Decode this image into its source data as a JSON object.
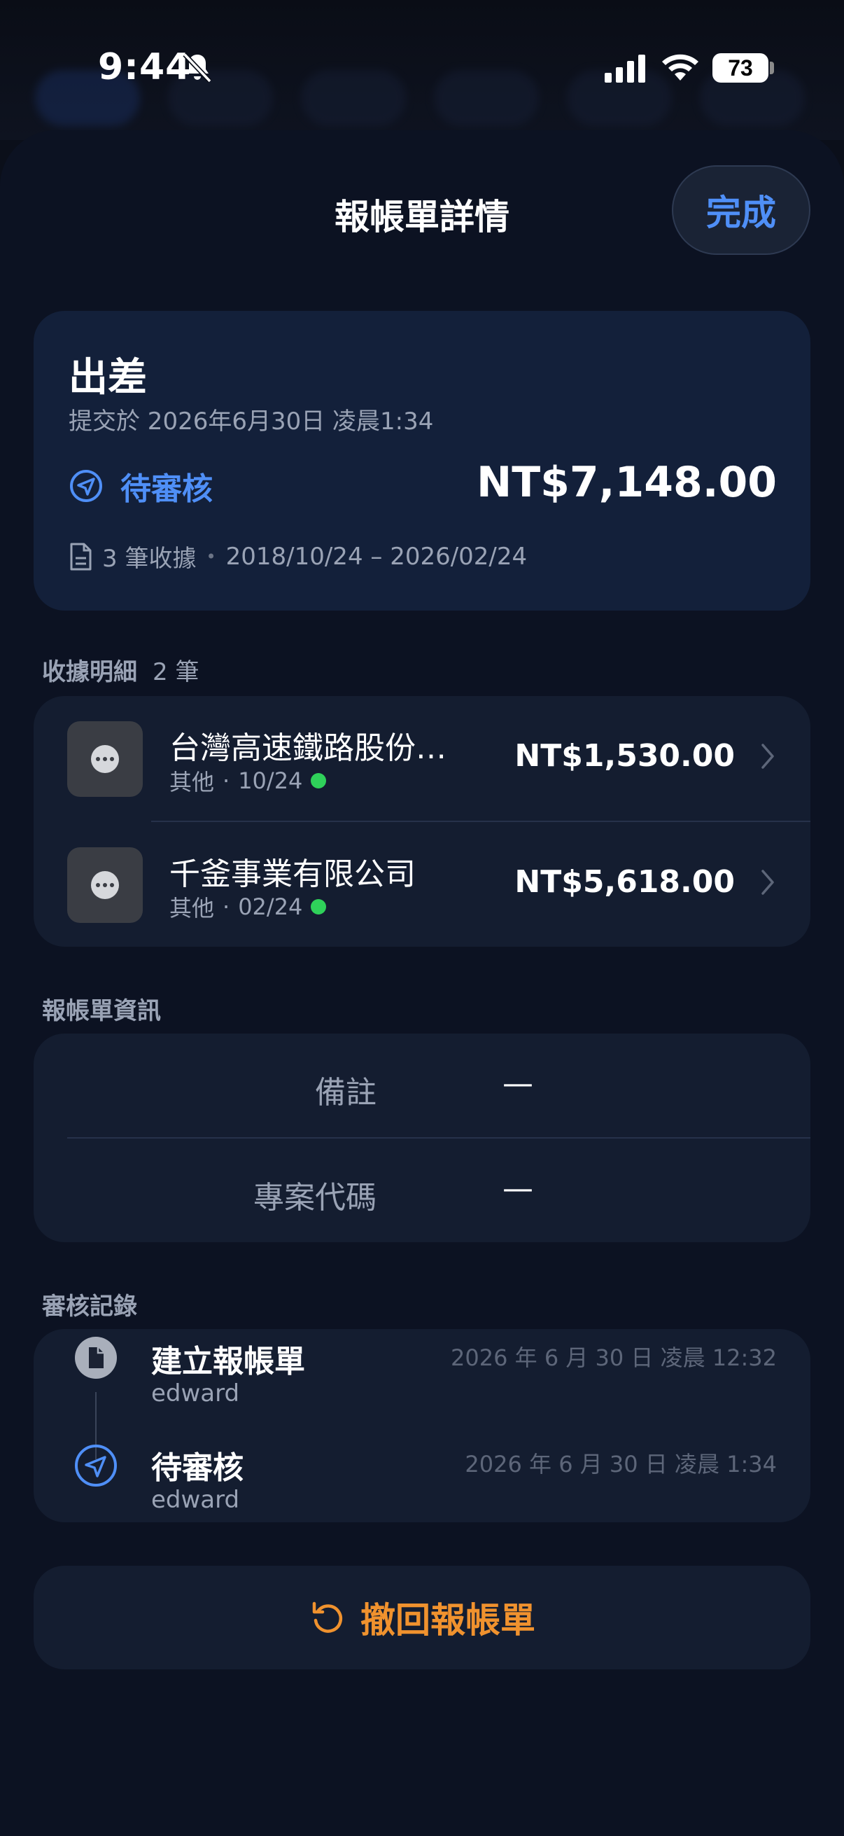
{
  "status_bar": {
    "time": "9:44",
    "battery": "73",
    "icons": [
      "bell-slash-icon",
      "cellular-signal-icon",
      "wifi-icon",
      "battery-icon"
    ]
  },
  "header": {
    "title": "報帳單詳情",
    "done_label": "完成"
  },
  "summary": {
    "title": "出差",
    "submitted": "提交於 2026年6月30日 凌晨1:34",
    "status": "待審核",
    "total": "NT$7,148.00",
    "receipt_count": "3 筆收據",
    "date_range": "2018/10/24 – 2026/02/24",
    "separator": "•"
  },
  "receipts_section": {
    "label": "收據明細",
    "count": "2 筆",
    "items": [
      {
        "merchant": "台灣高速鐵路股份…",
        "category": "其他",
        "date": "10/24",
        "amount": "NT$1,530.00"
      },
      {
        "merchant": "千釜事業有限公司",
        "category": "其他",
        "date": "02/24",
        "amount": "NT$5,618.00"
      }
    ],
    "meta_sep": "·"
  },
  "info_section": {
    "label": "報帳單資訊",
    "rows": [
      {
        "label": "備註",
        "value": "—"
      },
      {
        "label": "專案代碼",
        "value": "—"
      }
    ]
  },
  "log_section": {
    "label": "審核記錄",
    "entries": [
      {
        "title": "建立報帳單",
        "user": "edward",
        "time": "2026 年 6 月 30 日 凌晨 12:32"
      },
      {
        "title": "待審核",
        "user": "edward",
        "time": "2026 年 6 月 30 日 凌晨 1:34"
      }
    ]
  },
  "actions": {
    "withdraw_label": "撤回報帳單"
  },
  "colors": {
    "accent": "#4f8ff7",
    "warning": "#f0922e",
    "success": "#2fd15a",
    "background": "#0c1222",
    "card": "#141d30"
  }
}
